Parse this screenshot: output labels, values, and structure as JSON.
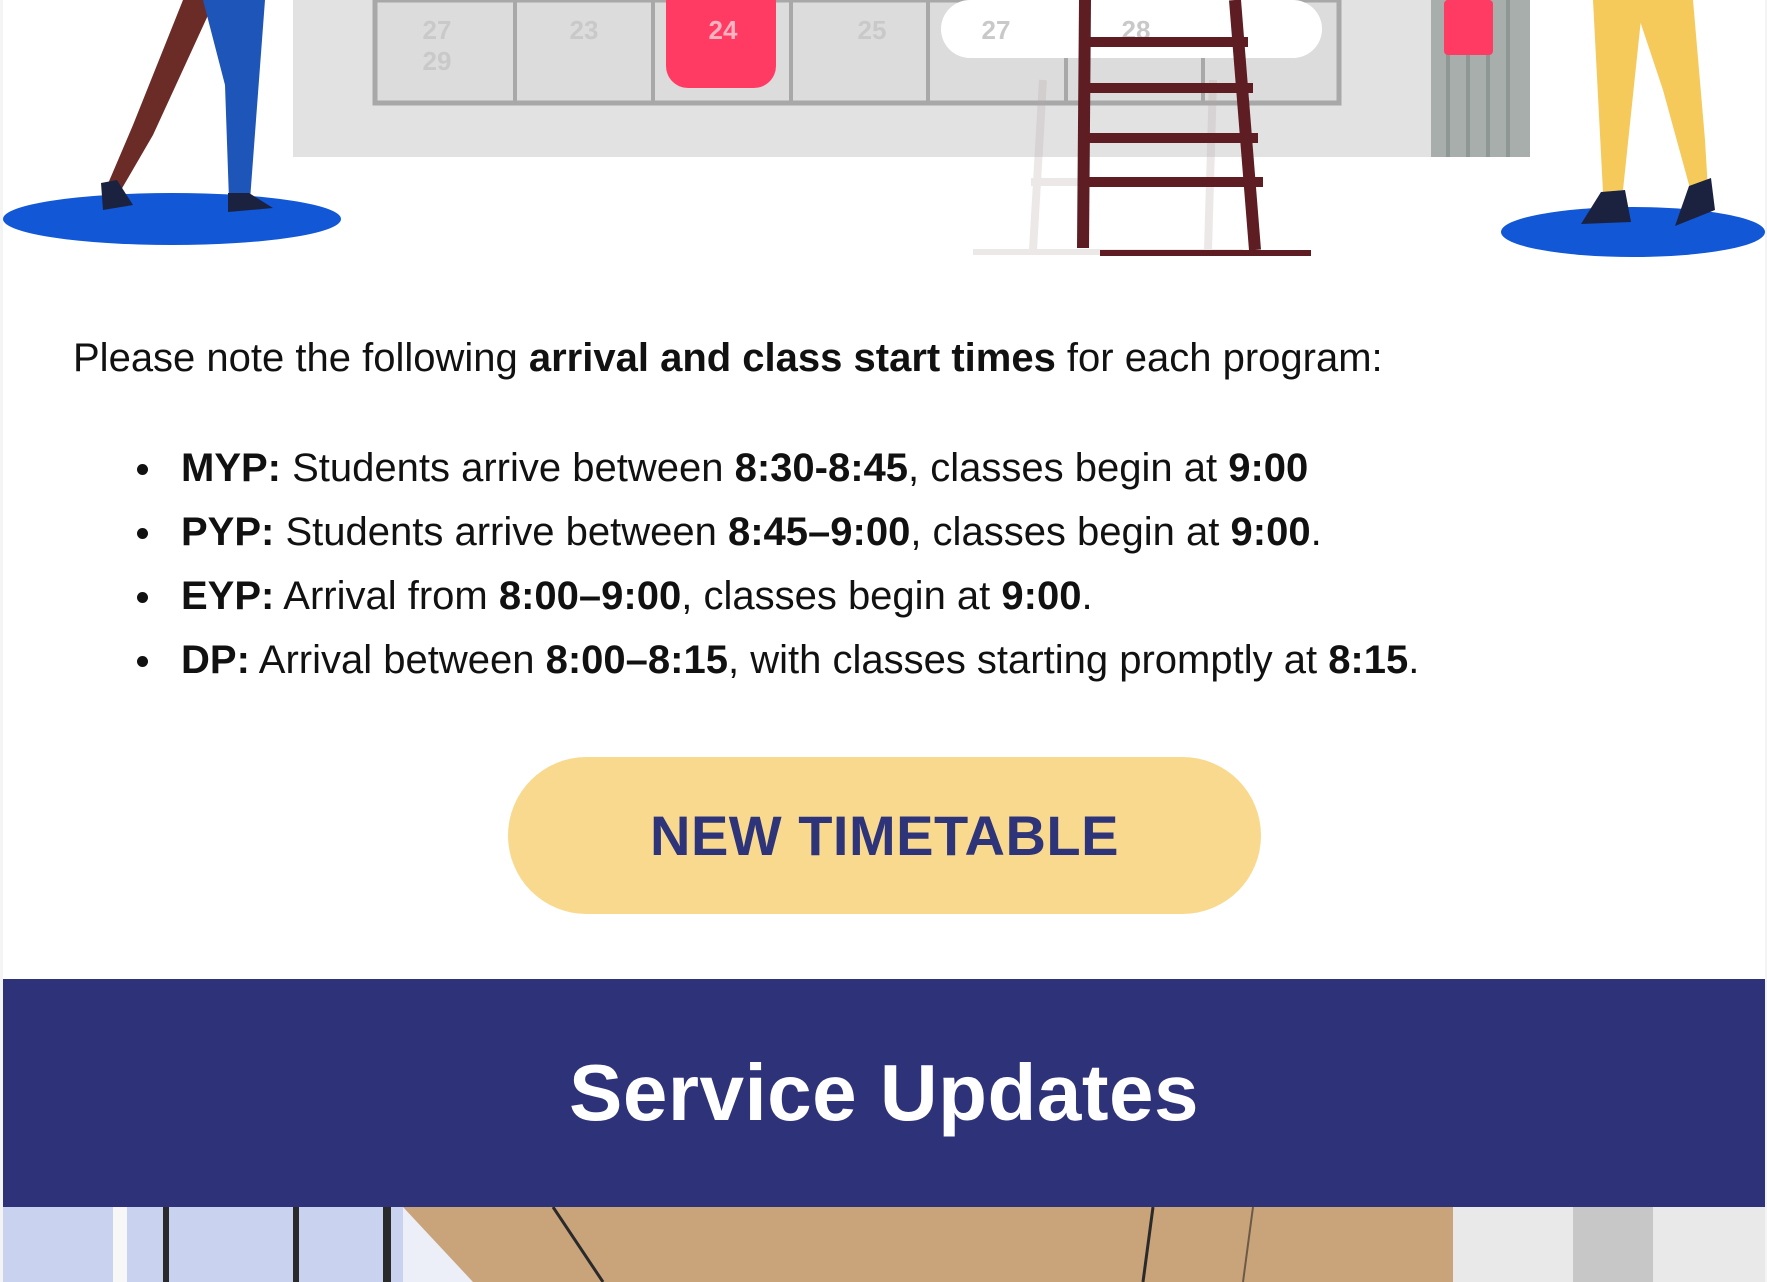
{
  "hero": {
    "calendar_dates": [
      "27",
      "29",
      "23",
      "24",
      "25",
      "27",
      "28"
    ]
  },
  "intro": {
    "before": "Please note the following ",
    "bold": "arrival and class start times",
    "after": " for each program:"
  },
  "schedule": [
    {
      "program": "MYP:",
      "t1": " Students arrive between ",
      "b1": "8:30-8:45",
      "t2": ", classes begin at ",
      "b2": "9:00",
      "t3": ""
    },
    {
      "program": "PYP:",
      "t1": " Students arrive between ",
      "b1": "8:45–9:00",
      "t2": ", classes begin at ",
      "b2": "9:00",
      "t3": "."
    },
    {
      "program": "EYP:",
      "t1": " Arrival from ",
      "b1": "8:00–9:00",
      "t2": ", classes begin at ",
      "b2": "9:00",
      "t3": "."
    },
    {
      "program": "DP:",
      "t1": " Arrival between ",
      "b1": "8:00–8:15",
      "t2": ", with classes starting promptly at ",
      "b2": "8:15",
      "t3": "."
    }
  ],
  "cta": {
    "label": "NEW TIMETABLE"
  },
  "banner": {
    "title": "Service Updates"
  },
  "colors": {
    "navy": "#2e3379",
    "button_yellow": "#f8d98e",
    "button_text": "#2e3479",
    "accent_pink": "#ff3b63",
    "figure_blue": "#1157d6"
  }
}
